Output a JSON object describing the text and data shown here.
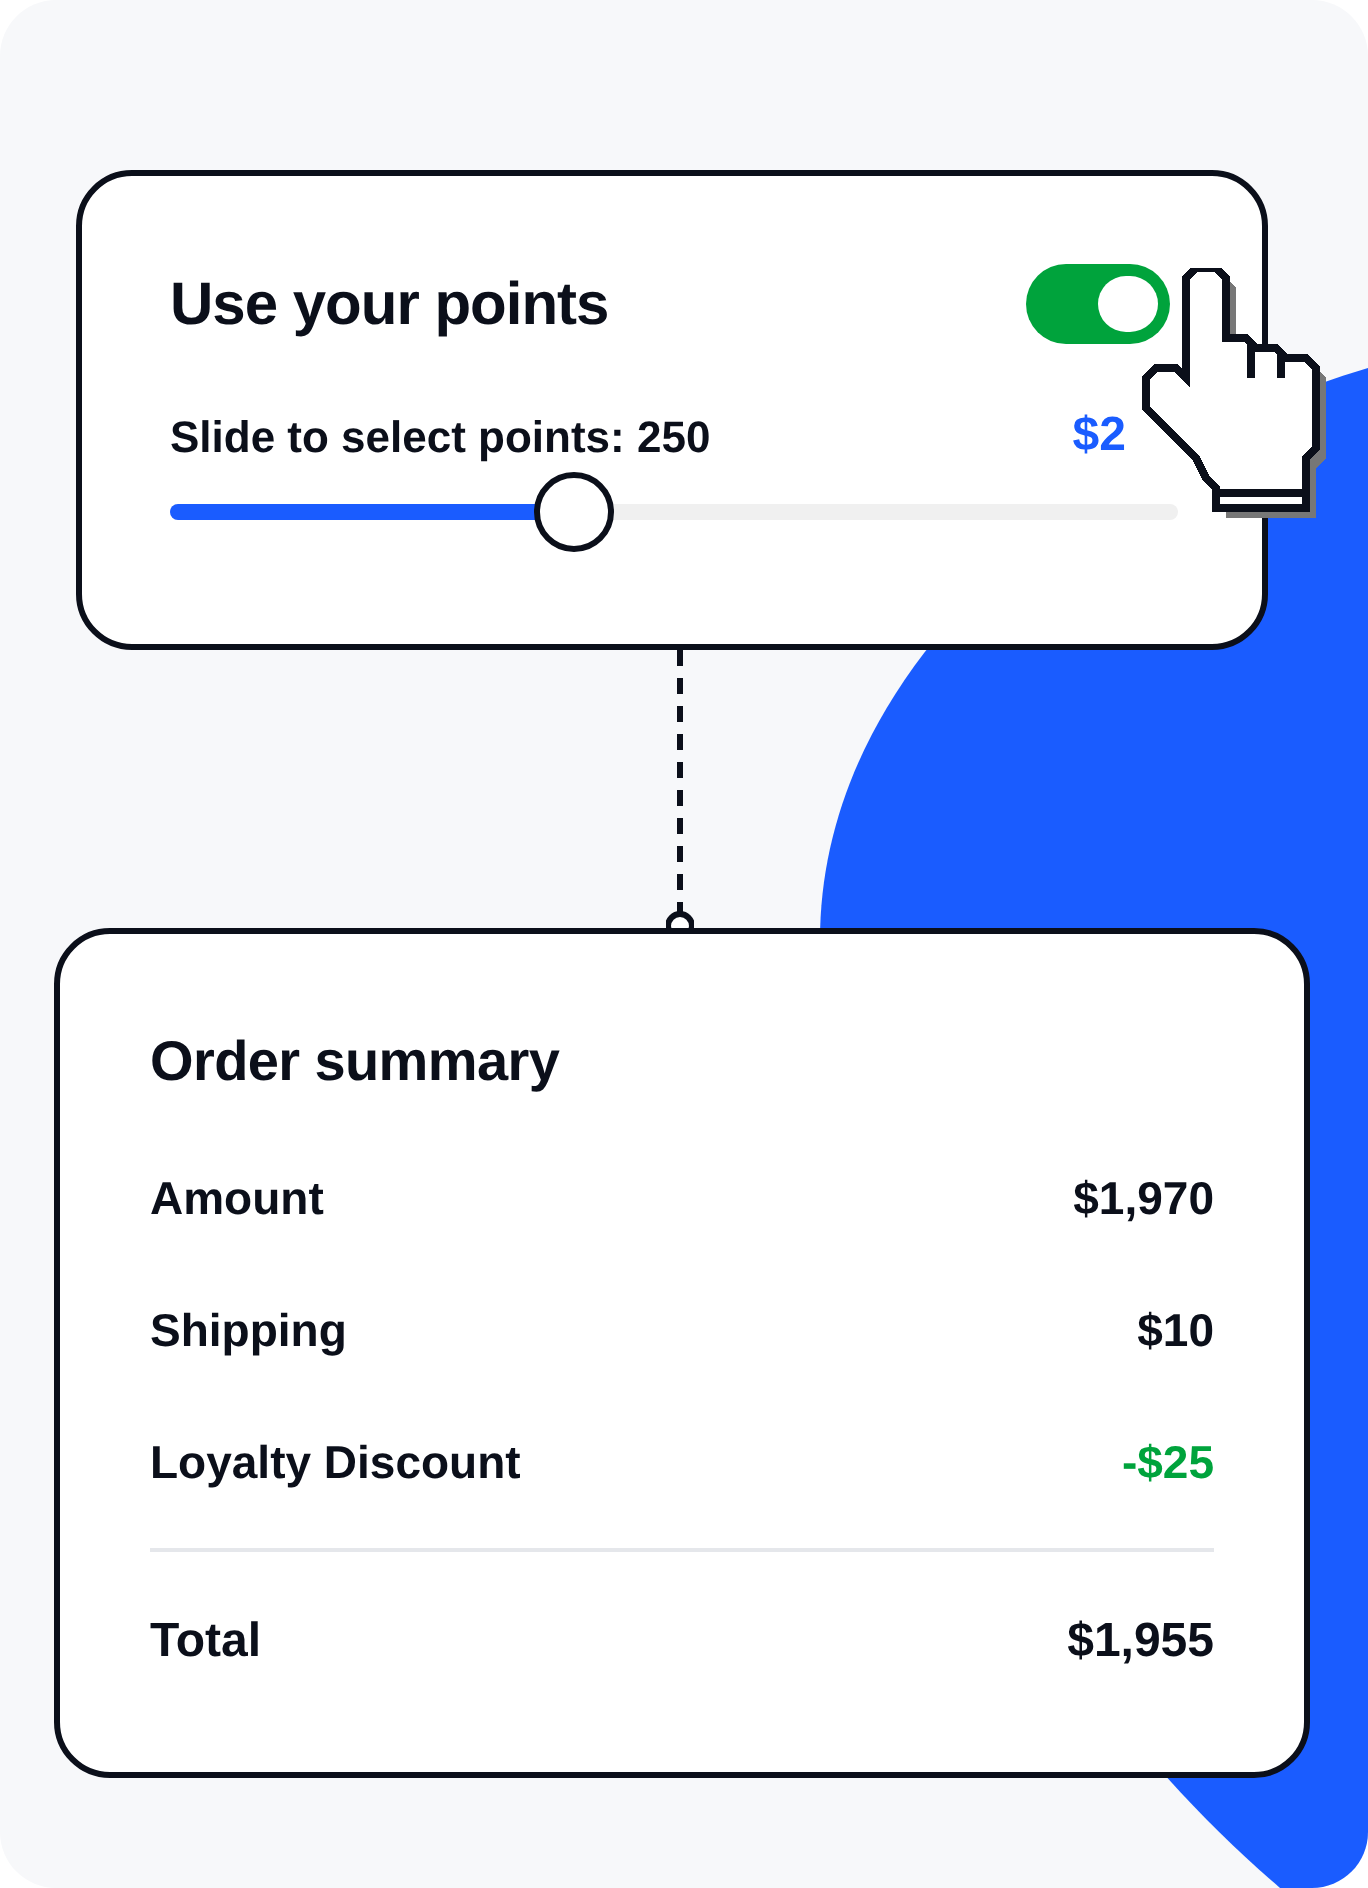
{
  "points_card": {
    "title": "Use your points",
    "toggle": {
      "on": true
    },
    "slider_label": "Slide to select points: 250",
    "value": "$2",
    "slider": {
      "level": 0.4
    }
  },
  "order_summary": {
    "title": "Order summary",
    "rows": [
      {
        "label": "Amount",
        "value": "$1,970",
        "kind": "charge"
      },
      {
        "label": "Shipping",
        "value": "$10",
        "kind": "charge"
      },
      {
        "label": "Loyalty Discount",
        "value": "-$25",
        "kind": "discount"
      }
    ],
    "total": {
      "label": "Total",
      "value": "$1,955"
    }
  }
}
